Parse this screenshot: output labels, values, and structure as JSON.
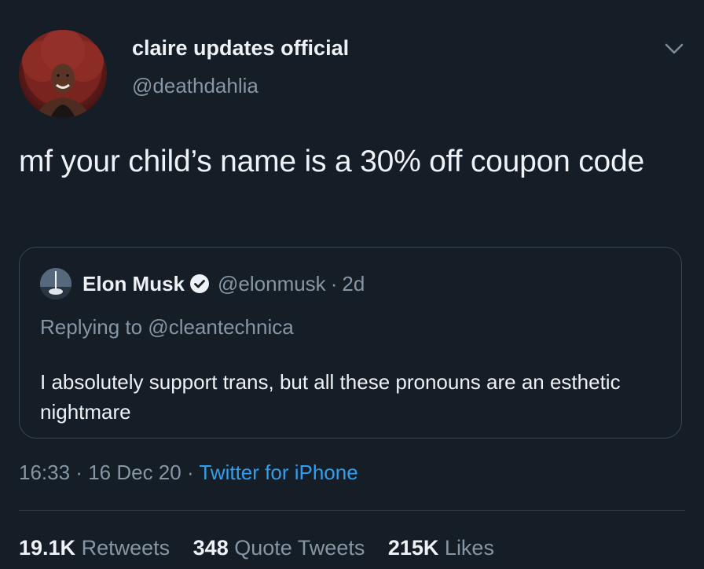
{
  "tweet": {
    "display_name": "claire updates official",
    "handle": "@deathdahlia",
    "text": "mf your child’s name is a 30% off coupon code",
    "menu_icon": "chevron-down-icon"
  },
  "quoted_tweet": {
    "name": "Elon Musk",
    "verified_icon": "verified-badge-icon",
    "handle": "@elonmusk",
    "separator": "·",
    "time": "2d",
    "replying_to": "Replying to @cleantechnica",
    "text": "I absolutely support trans, but all these pronouns are an esthetic nightmare"
  },
  "meta": {
    "time": "16:33",
    "sep1": " · ",
    "date": "16 Dec 20",
    "sep2": " · ",
    "source": "Twitter for iPhone"
  },
  "stats": {
    "retweets_count": "19.1K",
    "retweets_label": "Retweets",
    "quotes_count": "348",
    "quotes_label": "Quote Tweets",
    "likes_count": "215K",
    "likes_label": "Likes"
  },
  "colors": {
    "background": "#151d27",
    "text": "#eef2f6",
    "secondary": "#8796a4",
    "link": "#2f9fee"
  }
}
